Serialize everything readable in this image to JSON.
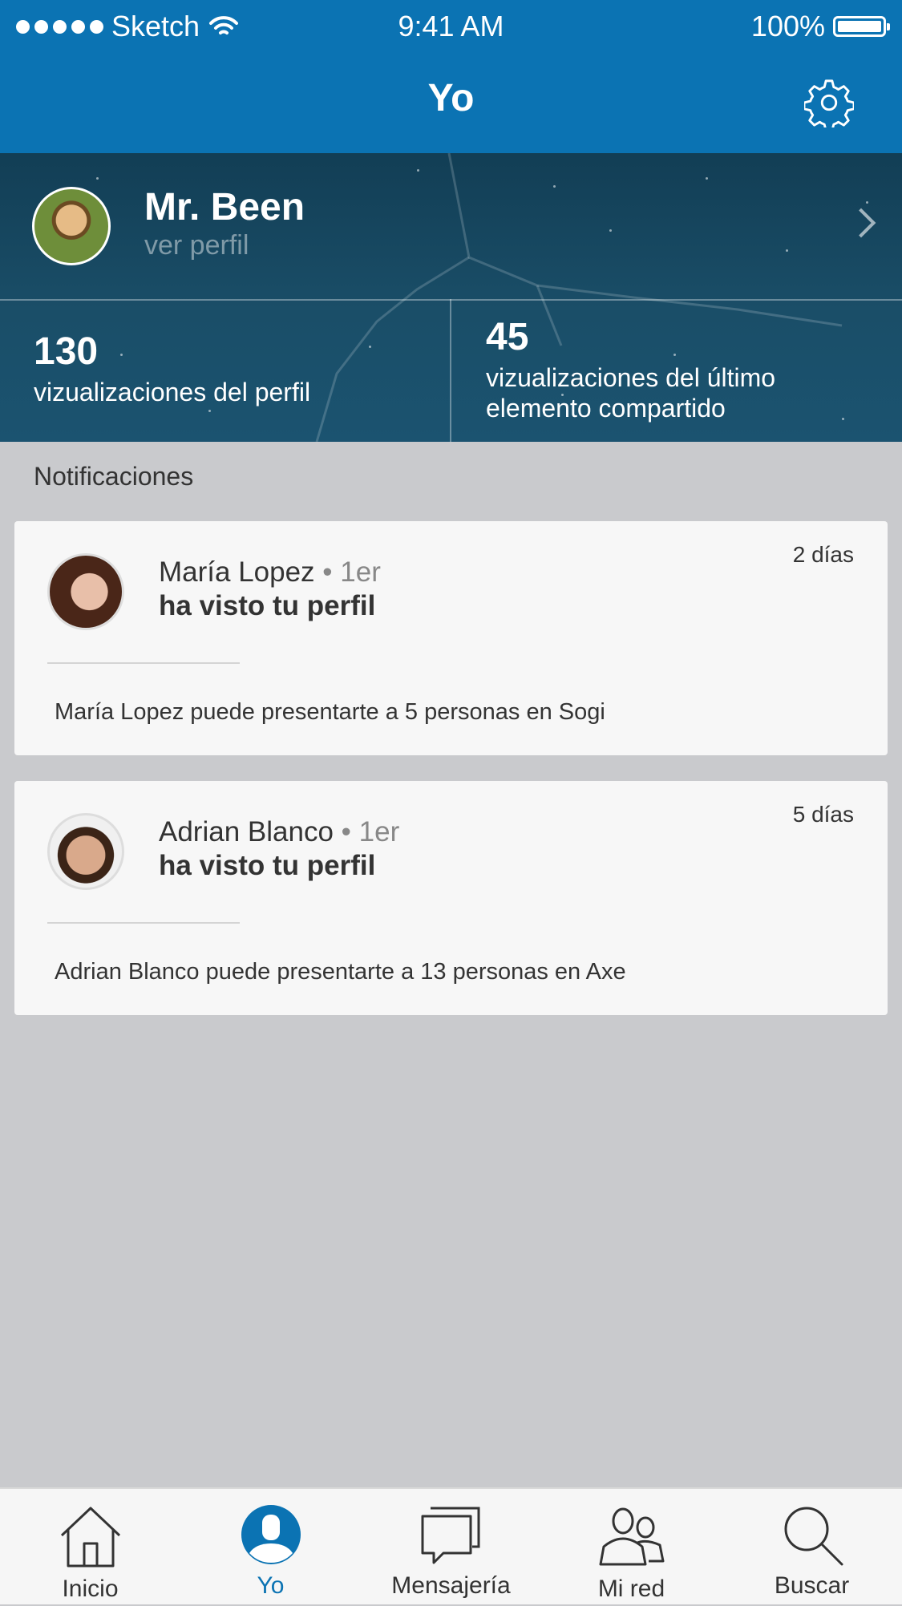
{
  "status_bar": {
    "carrier": "Sketch",
    "time": "9:41 AM",
    "battery": "100%"
  },
  "nav": {
    "title": "Yo",
    "settings_icon": "gear-icon"
  },
  "profile": {
    "name": "Mr. Been",
    "subtitle": "ver perfil",
    "stats": [
      {
        "value": "130",
        "label_lines": [
          "vizualizaciones del perfil"
        ]
      },
      {
        "value": "45",
        "label_lines": [
          "vizualizaciones del último",
          "elemento compartido"
        ]
      }
    ]
  },
  "notifications": {
    "title": "Notificaciones",
    "items": [
      {
        "name": "María Lopez",
        "degree": "1er",
        "action": "ha visto tu perfil",
        "time": "2 días",
        "message": "María Lopez puede presentarte a 5 personas en Sogi"
      },
      {
        "name": "Adrian Blanco",
        "degree": "1er",
        "action": "ha visto tu perfil",
        "time": "5 días",
        "message": "Adrian Blanco puede presentarte a 13 personas en Axe"
      }
    ]
  },
  "tabbar": {
    "active": "Yo",
    "tabs": [
      {
        "label": "Inicio",
        "icon": "home-icon"
      },
      {
        "label": "Yo",
        "icon": "profile-icon"
      },
      {
        "label": "Mensajería",
        "icon": "messages-icon"
      },
      {
        "label": "Mi red",
        "icon": "network-icon"
      },
      {
        "label": "Buscar",
        "icon": "search-icon"
      }
    ]
  },
  "colors": {
    "brand": "#0b73b3",
    "background": "#c9cacd",
    "card": "#f7f7f7"
  }
}
